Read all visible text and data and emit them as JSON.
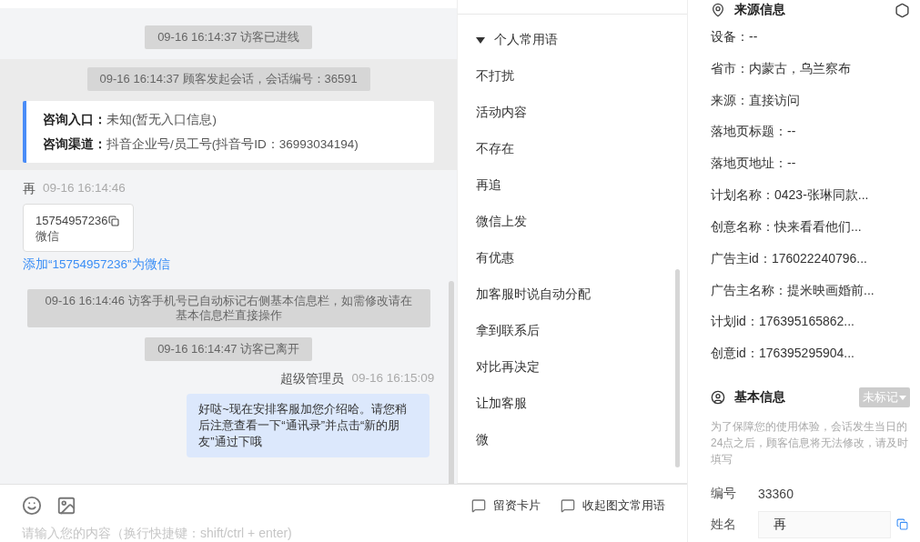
{
  "chat": {
    "items": [
      {
        "kind": "system",
        "text": "09-16 16:14:37 访客已进线"
      },
      {
        "kind": "session",
        "text": "09-16 16:14:37 顾客发起会话，会话编号：36591",
        "fields": [
          {
            "label": "咨询入口：",
            "value": "未知(暂无入口信息)"
          },
          {
            "label": "咨询渠道：",
            "value": "抖音企业号/员工号(抖音号ID：36993034194)"
          }
        ]
      },
      {
        "kind": "visitor",
        "sender": "再",
        "time": "09-16 16:14:46",
        "card": {
          "number": "15754957236",
          "type": "微信"
        },
        "link": "添加“15754957236”为微信"
      },
      {
        "kind": "system",
        "text": "09-16 16:14:46 访客手机号已自动标记右侧基本信息栏，如需修改请在基本信息栏直接操作"
      },
      {
        "kind": "system",
        "text": "09-16 16:14:47 访客已离开"
      },
      {
        "kind": "agent",
        "sender": "超级管理员",
        "time": "09-16 16:15:09",
        "text": "好哒~现在安排客服加您介绍哈。请您稍后注意查看一下“通讯录”并点击“新的朋友”通过下哦"
      }
    ]
  },
  "composer": {
    "placeholder": "请输入您的内容（换行快捷键：shift/ctrl + enter)"
  },
  "phrases": {
    "title": "个人常用语",
    "expanded": true,
    "items": [
      "不打扰",
      "活动内容",
      "不存在",
      "再追",
      "微信上发",
      "有优惠",
      "加客服时说自动分配",
      "拿到联系后",
      "对比再决定",
      "让加客服",
      "微"
    ]
  },
  "footer_buttons": [
    "留资卡片",
    "收起图文常用语"
  ],
  "source_info": {
    "title": "来源信息",
    "fields": [
      "设备：--",
      "省市：内蒙古，乌兰察布",
      "来源：直接访问",
      "落地页标题：--",
      "落地页地址：--",
      "计划名称：0423-张琳同款...",
      "创意名称：快来看看他们...",
      "广告主id：176022240796...",
      "广告主名称：提米映画婚前...",
      "计划id：176395165862...",
      "创意id：176395295904..."
    ]
  },
  "basic_info": {
    "title": "基本信息",
    "tag": "未标记",
    "notice": "为了保障您的使用体验，会话发生当日的24点之后，顾客信息将无法修改，请及时填写",
    "fields": [
      {
        "kind": "text",
        "label": "编号",
        "value": "33360"
      },
      {
        "kind": "input",
        "label": "姓名",
        "value": "再"
      }
    ]
  }
}
